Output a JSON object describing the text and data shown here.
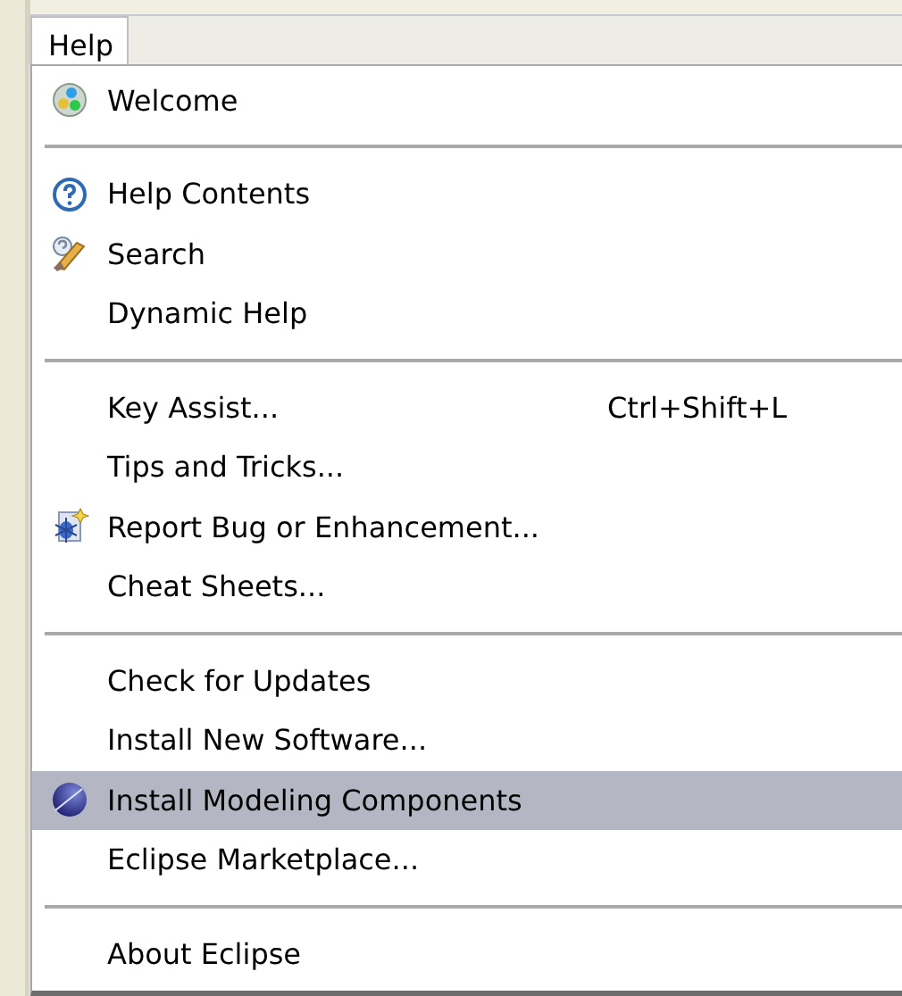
{
  "menu_bar": {
    "items": [
      {
        "label": "Help",
        "selected": true
      }
    ]
  },
  "menu": {
    "groups": [
      [
        {
          "label": "Welcome",
          "selected": false
        }
      ],
      [
        {
          "label": "Help Contents",
          "selected": false
        },
        {
          "label": "Search",
          "selected": false
        },
        {
          "label": "Dynamic Help",
          "selected": false
        }
      ],
      [
        {
          "label": "Key Assist...",
          "shortcut": "Ctrl+Shift+L",
          "selected": false
        },
        {
          "label": "Tips and Tricks...",
          "selected": false
        },
        {
          "label": "Report Bug or Enhancement...",
          "selected": false
        },
        {
          "label": "Cheat Sheets...",
          "selected": false
        }
      ],
      [
        {
          "label": "Check for Updates",
          "selected": false
        },
        {
          "label": "Install New Software...",
          "selected": false
        },
        {
          "label": "Install Modeling Components",
          "selected": true
        },
        {
          "label": "Eclipse Marketplace...",
          "selected": false
        }
      ],
      [
        {
          "label": "About Eclipse",
          "selected": false
        }
      ]
    ]
  }
}
